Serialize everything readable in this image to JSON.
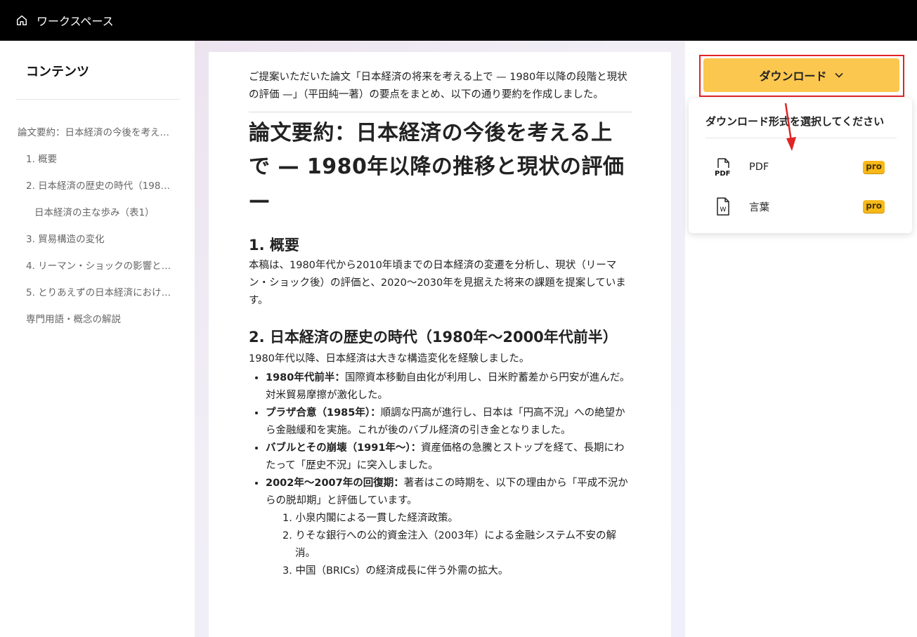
{
  "topbar": {
    "workspace_label": "ワークスペース"
  },
  "sidebar": {
    "heading": "コンテンツ",
    "toc": [
      {
        "label": "論文要約：日本経済の今後を考え…",
        "level": 0
      },
      {
        "label": "1. 概要",
        "level": 1
      },
      {
        "label": "2. 日本経済の歴史の時代（1980…",
        "level": 1
      },
      {
        "label": "日本経済の主な歩み（表1）",
        "level": 2
      },
      {
        "label": "3. 貿易構造の変化",
        "level": 1
      },
      {
        "label": "4. リーマン・ショックの影響と…",
        "level": 1
      },
      {
        "label": "5. とりあえずの日本経済におけ…",
        "level": 1
      },
      {
        "label": "専門用語・概念の解説",
        "level": 1
      }
    ]
  },
  "doc": {
    "intro": "ご提案いただいた論文「日本経済の将来を考える上で — 1980年以降の段階と現状の評価 —」（平田純一著）の要点をまとめ、以下の通り要約を作成しました。",
    "title": "論文要約：日本経済の今後を考える上で — 1980年以降の推移と現状の評価 —",
    "s1_heading": "1. 概要",
    "s1_body": "本稿は、1980年代から2010年頃までの日本経済の変遷を分析し、現状（リーマン・ショック後）の評価と、2020〜2030年を見据えた将来の課題を提案しています。",
    "s2_heading": "2. 日本経済の歴史の時代（1980年〜2000年代前半）",
    "s2_lead": "1980年代以降、日本経済は大きな構造変化を経験しました。",
    "bullets": [
      {
        "bold": "1980年代前半：",
        "text": "国際資本移動自由化が利用し、日米貯蓄差から円安が進んだ。対米貿易摩擦が激化した。"
      },
      {
        "bold": "プラザ合意（1985年）：",
        "text": "順調な円高が進行し、日本は「円高不況」への絶望から金融緩和を実施。これが後のバブル経済の引き金となりました。"
      },
      {
        "bold": "バブルとその崩壊（1991年〜）：",
        "text": "資産価格の急騰とストップを経て、長期にわたって「歴史不況」に突入しました。"
      },
      {
        "bold": "2002年〜2007年の回復期：",
        "text": "著者はこの時期を、以下の理由から「平成不況からの脱却期」と評価しています。"
      }
    ],
    "numbered": [
      "1. 小泉内閣による一貫した経済政策。",
      "2. りそな銀行への公的資金注入（2003年）による金融システム不安の解消。",
      "3. 中国（BRICs）の経済成長に伴う外需の拡大。"
    ]
  },
  "download": {
    "button_label": "ダウンロード",
    "menu_heading": "ダウンロード形式を選択してください",
    "options": [
      {
        "label": "PDF",
        "badge": "pro",
        "icon": "pdf-file-icon"
      },
      {
        "label": "言葉",
        "badge": "pro",
        "icon": "word-file-icon"
      }
    ]
  },
  "colors": {
    "download_button": "#fbc74f",
    "highlight_outline": "#e02424",
    "pro_badge": "#f7b919",
    "topbar": "#000000"
  }
}
